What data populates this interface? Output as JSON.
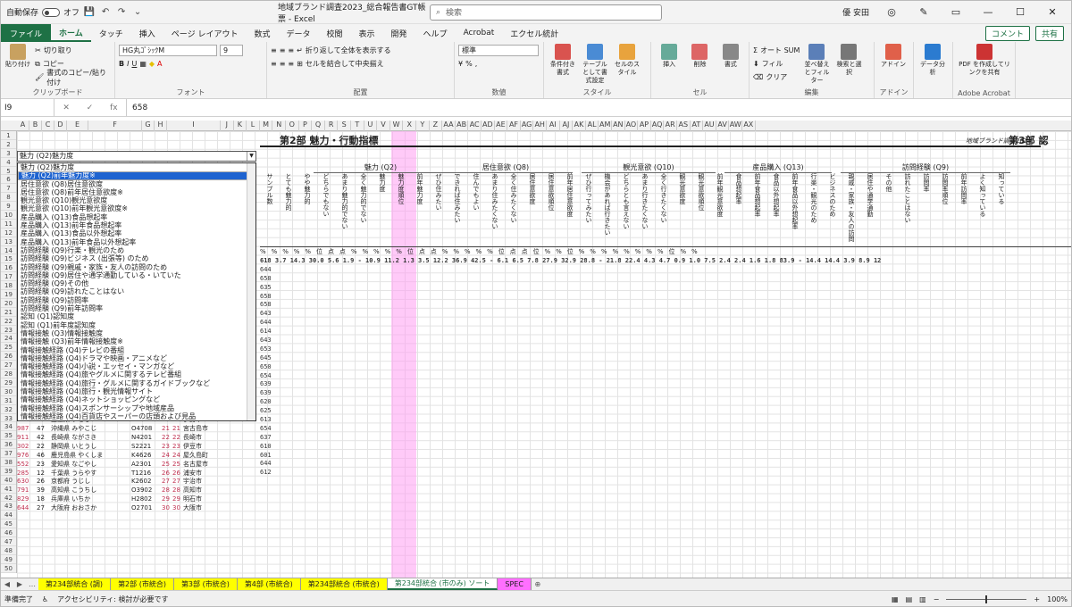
{
  "titlebar": {
    "autosave": "自動保存",
    "autosave_state": "オフ",
    "filename": "地域ブランド調査2023_総合報告書GT帳票 - Excel",
    "search_placeholder": "検索",
    "user": "優 安田"
  },
  "menu": {
    "file": "ファイル",
    "tabs": [
      "ホーム",
      "タッチ",
      "挿入",
      "ページ レイアウト",
      "数式",
      "データ",
      "校閲",
      "表示",
      "開発",
      "ヘルプ",
      "Acrobat",
      "エクセル統計"
    ],
    "comment": "コメント",
    "share": "共有"
  },
  "ribbon": {
    "clipboard": {
      "paste": "貼り付け",
      "cut": "切り取り",
      "copy": "コピー",
      "format_painter": "書式のコピー/貼り付け",
      "label": "クリップボード"
    },
    "font": {
      "name": "HG丸ｺﾞｼｯｸM",
      "size": "9",
      "label": "フォント"
    },
    "align": {
      "wrap": "折り返して全体を表示する",
      "merge": "セルを結合して中央揃え",
      "label": "配置"
    },
    "number": {
      "format": "標準",
      "label": "数値"
    },
    "style": {
      "cond": "条件付き書式",
      "table": "テーブルとして書式設定",
      "cell": "セルのスタイル",
      "label": "スタイル"
    },
    "cells": {
      "insert": "挿入",
      "delete": "削除",
      "format": "書式",
      "label": "セル"
    },
    "edit": {
      "autosum": "オート SUM",
      "fill": "フィル",
      "clear": "クリア",
      "sort": "並べ替えとフィルター",
      "find": "検索と選択",
      "label": "編集"
    },
    "addin": {
      "addin": "アドイン",
      "label": "アドイン"
    },
    "analysis": {
      "data": "データ分析"
    },
    "acrobat": {
      "pdf": "PDF を作成してリンクを共有",
      "label": "Adobe Acrobat"
    }
  },
  "formula": {
    "cell": "I9",
    "value": "658"
  },
  "colheaders": [
    "A",
    "B",
    "C",
    "D",
    "E",
    "F",
    "G",
    "H",
    "I",
    "J",
    "K",
    "L",
    "M",
    "N",
    "O",
    "P",
    "Q",
    "R",
    "S",
    "T",
    "U",
    "V",
    "W",
    "X",
    "Y",
    "Z",
    "AA",
    "AB",
    "AC",
    "AD",
    "AE",
    "AF",
    "AG",
    "AH",
    "AI",
    "AJ",
    "AK",
    "AL",
    "AM",
    "AN",
    "AO",
    "AP",
    "AQ",
    "AR",
    "AS",
    "AT",
    "AU",
    "AV",
    "AW",
    "AX"
  ],
  "sheet": {
    "section2": "第2部 魅力・行動指標",
    "section3": "第3部 認",
    "brand": "地域ブランド調査2023",
    "groups": [
      "魅力 (Q2)",
      "居住意欲 (Q8)",
      "観光意欲 (Q10)",
      "産品購入 (Q13)",
      "訪問経験 (Q9)"
    ],
    "dropdown_value": "魅力 (Q2)魅力度",
    "list": [
      "魅力 (Q2)魅力度",
      "魅力 (Q2)前年魅力度※",
      "居住意欲 (Q8)居住意欲度",
      "居住意欲 (Q8)前年居住意欲度※",
      "観光意欲 (Q10)観光意欲度",
      "観光意欲 (Q10)前年観光意欲度※",
      "産品購入 (Q13)食品想起率",
      "産品購入 (Q13)前年食品想起率",
      "産品購入 (Q13)食品以外想起率",
      "産品購入 (Q13)前年食品以外想起率",
      "訪問経験 (Q9)行楽・観光のため",
      "訪問経験 (Q9)ビジネス (出張等) のため",
      "訪問経験 (Q9)親戚・家族・友人の訪問のため",
      "訪問経験 (Q9)居住や通学通勤している・いていた",
      "訪問経験 (Q9)その他",
      "訪問経験 (Q9)訪れたことはない",
      "訪問経験 (Q9)訪問率",
      "訪問経験 (Q9)前年訪問率",
      "認知 (Q1)認知度",
      "認知 (Q1)前年度認知度",
      "情報接触 (Q3)情報接触度",
      "情報接触 (Q3)前年情報接触度※",
      "情報接触経路 (Q4)テレビの番組",
      "情報接触経路 (Q4)ドラマや映画・アニメなど",
      "情報接触経路 (Q4)小説・エッセイ・マンガなど",
      "情報接触経路 (Q4)旅やグルメに関するテレビ番組",
      "情報接触経路 (Q4)旅行・グルメに関するガイドブックなど",
      "情報接触経路 (Q4)旅行・観光情報サイト",
      "情報接触経路 (Q4)ネットショッピングなど",
      "情報接触経路 (Q4)スポンサーシップや地域産品",
      "情報接触経路 (Q4)百貨店やスーパーの店頭および見品"
    ],
    "vheaders": [
      "サンプル数",
      "とても魅力的",
      "やや魅力的",
      "どちらでもない",
      "あまり魅力的でない",
      "全く魅力的でない",
      "魅力度",
      "魅力度順位",
      "前年魅力度",
      "ぜひ住みたい",
      "できれば住みたい",
      "住んでもよい",
      "あまり住みたくない",
      "全く住みたくない",
      "居住意欲度",
      "居住意欲順位",
      "前年居住意欲度",
      "ぜひ行ってみたい",
      "機会があれば行きたい",
      "どちらとも言えない",
      "あまり行きたくない",
      "全く行きたくない",
      "観光意欲度",
      "観光意欲順位",
      "前年観光意欲度",
      "食品想起率",
      "前年食品想起率",
      "食品以外想起率",
      "前年食品以外想起率",
      "行楽・観光のため",
      "ビジネスのため",
      "親戚・家族・友人の訪問",
      "居住や通学通勤",
      "その他",
      "訪れたことはない",
      "訪問率",
      "訪問率順位",
      "前年訪問率",
      "よく知っている",
      "知っている"
    ],
    "totals": "618  3.7 14.3 30.0 5.6 1.9  -  10.9 11.2  1.3 3.5 12.2 36.9 42.5  -  6.1 6.5  7.8 27.9 32.9 28.8  - 21.8 22.4  4.3 4.7  0.9 1.0  7.5 2.4 2.4 1.6 1.8 83.9  - 14.4 14.4  3.9 8.9 12",
    "rows": [
      [
        "644",
        "36.6 45.4 13.9 2.3 0.6 1 59.4 63.9 10.0 10.9 25.7 26.5 25.5 2 21.9 23.7 40.6 41.2 11.3 6.2 1 61.2 65.9 2 43.8 47.2 39 3.6 4.3 28.9 5.8 5.1 6.2 2.0 59.2 15 40.1 40.2 17.9 29.7 25"
      ],
      [
        "658",
        "36.7 42.2 14.7 2.9 1.6 2 57.8 59.5 8.6 11.9 26.9 24.5 25.5 3 21.3 22.3 39.1 36.9 13.1 8.6 3 57.5 60.0 25 21.9 23.3 17 6.4 7.6 44.5 6.9 7.6 3.5 2.2 41.4 1 55.9 56.9 26.5 31.8 24"
      ],
      [
        "635",
        "32.9 47.3 15.0 1.6 1.7 3 56.6 58.7 4.2 8.6 25.2 30.0 31.5 20 12.8 15.9 38.2 43.4 9.8 7.5 2 59.9 62.3 5 33.8 35.5 49 3.0 3.1 27.2 4.3 3.9 1.6 0.7 69.8 34 33.8 33.9 11.7 26.0 25"
      ],
      [
        "658",
        "25.2 51.1 16.0 3.2 1.6 4 53.1 55.9 5.4 11.0 29.9 30.3 21.1 7 18.9 19.5 35.3 40.6 13.7 6.1 5 53.6 53.2 86 17.1 16.4 47 6.2 6.3 17.4 3.4 2.3 2.8 2.6 61.5 26 35.4 37.4 14.6 29.8 25"
      ],
      [
        "658",
        "29.6 44.7 18.0 2.5 1.0 5 52.0 52.1 3.7 15.2 30.5 26.2 20.9 6 18.9 20.4 30.7 42.8 14.2 10.1 7 52.1 51.9 113 8.9 10.4 60 2.8 5.2 34.0 2.9 2.6 2.1 2.0 53.5 2 41.2 38.8 18.3 27.0 28"
      ],
      [
        "643",
        "30.9 41.7 20.4 2.5 0.8 6 51.8 55.7 8.3 9.8 31.0 26.1 21.3 4 21.0 25.9 28.6 48.8 14.2 6.8 10 50.5 54.0 49 16.3 23.4 266 0.9 1.4 32.5 7.2 7.0 4.8 3.5 53.3 9 44.6 45.8 23.3 29.5 26"
      ],
      [
        "644",
        "30.8 39.7 22.6 3.5 1.7 7 50.7 56.1 11.3 13.1 31.8 25.9 15.3 1 26.9 21.6 38.4 31.5 18.2 9.0 11 51.5 51.0 59 12.4 14.1 24 8.7 9.1 37.1 10.7 11.0 5.7 4.0 44.6 2 55.6 56.7 26.0 31.6 22"
      ],
      [
        "614",
        "26.0 49.3 18.3 2.1 1.5 8 50.6 55.8 4.7 6.6 22.0 28.8 36.9 29 13.6 14.8 28.5 50.8 10.0 9.7 4 53.9 57.8 20 23.5 29.8 14 7.6 9.3 27.0 2.1 3.2 1.0 1.3 66.3 41 32.4 29.5 8.9 22.2 23"
      ],
      [
        "643",
        "29.0 34.8 25.0 5.7 1.3 9 48.8 49.0 6.1 6.1 19.4 27.8 34.6 17 15.0 17.9 31.3 39.1 14.0 13.5 8 50.9 54.8 23 19.6 27.1 31 4.3 6.5 27.7 2.6 1.8 2.4 1.8 63.1 31 34.9 32.7 17.2 34.0 24"
      ],
      [
        "653",
        "25.1 42.1 24.2 2.8 1.9 10 46.1 49.8 4.6 10.5 26.0 27.0 24.3 10 16.3 17.7 24.4 42.6 19.8 11.1 14 47.6 46.3 270 4.5 4.4 45 4.5 4.6 25.7 3.6 2.3 1.0 1.2 66.4 37 30.3 28.6 12.9 27.6 22"
      ],
      [
        "645",
        "23.9 43.3 19.5 3.5 1.1 11 45.5 49.0 3.1 7.1 21.1 29.0 36.8 48 12.0 16.9 26.0 47.7 13.0 12.1 12 49.9 54.5 43 17.1 22.4 13 8.4 11.0 17.8 1.6 1.8 0.9 1.6 75.5 146 22.5 21.5 8.8 25.3 21"
      ],
      [
        "650",
        "20.1 50.1 23.3 2.9 2.0 12 45.1 45.6 6.4 7.7 26.5 31.2 25.6 9 16.9 16.4 27.2 44.0 14.9 10.2 13 51.5 52.4 29 19.4 24.8 46 4.1 4.7 24.6 6.1 4.7 4.3 2.2 60.4 39 32.4 37.5 11.7 30.5 26"
      ],
      [
        "654",
        "16.5 53.1 23.9 2.2 1.4 13 43.0 45.8 2.8 9.1 23.7 31.8 29.9 31 13.3 15.4 22.7 46.9 17.9 10.6 18 46.1 51.2 158 7.0 10.5 144 1.4 2.0 31.7 3.3 2.7 1.5 1.8 58.3 18 38.9 40.1 9.6 26.6 25"
      ],
      [
        "639",
        "25.5 34.5 26.7 3.1 1.9 14 42.8 43.4 5.9 10.1 18.3 30.0 35.0 15 15.6 18.8 25.2 42.1 17.5 11.6 17 46.9 49.7 15 26.1 30.3 26 5.2 5.6 25.4 2.7 3.0 1.5 2.2 65.1 57 28.3 25.4 11.0 27.8 24"
      ],
      [
        "639",
        "22.3 40.9 26.0 3.2 2.6 15 42.8 43.0 5.2 6.9 20.4 32.4 34.6 55 11.7 13.4 24.1 40.5 15.9 14.2 16 47.7 48.3 243 4.8 6.8 66 2.5 3.7 24.3 2.8 2.6 1.7 1.2 66.9 51 30.3 30.4 13.3 22.9 25"
      ],
      [
        "620",
        "28.2 32.8 27.8 4.1 1.5 16 42.4 43.6 6.3 8.2 18.5 30.0 36.3 34 13.1 11.9 30.7 31.5 19.7 14.3 20 44.8 46.7 17 25.3 27.8 28 5.0 5.7 23.2 2.4 3.1 1.2 2.1 64.4 30 35.0 35.1 13.2 24.5 23"
      ],
      [
        "625",
        "18.9 45.1 24.8 4.3 1.1 17 40.7 42.3 2.2 9.5 24.9 32.1 30.5 26 13.7 15.5 21.1 45.2 17.3 13.6 21 43.2 46.3 194 6.1 6.9 40 4.7 6.0 24.8 3.0 2.4 1.3 1.1 66.7 53 28.6 29.4 10.4 27.7 26"
      ],
      [
        "613",
        "15.6 50.3 25.6 2.6 1.2 18 40.7 44.3 1.8 4.5 17.4 36.2 38.9 130 6.3 8.4 22.4 40.6 16.2 12.3 17 46.2 48.0 153 7.2 8.0 91 2.5 3.0 20.8 1.5 2.3 1.0 0.8 72.1 93 22.2 22.5 6.1 22.8 26"
      ],
      [
        "654",
        "17.3 46.6 24.7 3.6 1.0 19 40.5 38.4 3.0 7.5 21.8 31.8 33.0 43 12.2 13.8 23.9 43.2 17.5 13.0 20 45.4 45.5 254 4.7 6.5 37 3.9 5.3 30.6 2.7 2.7 1.6 1.9 59.9 21 37.6 34.2 16.2 27.2 25"
      ],
      [
        "637",
        "23.0 37.5 31.2 5.3 2.9 20 38.5 38.7 4.3 9.1 17.9 27.9 38.4 44 12.2 12.9 23.9 39.8 15.4 13.6 18 46.1 47.5 18 25.3 26.8 10 8.7 7.7 23.7 3.0 2.1 1.4 1.1 66.9 59 29.0 27.4 10.8 27.0 27"
      ],
      [
        "610",
        "16.8 43.2 27.1 6.2 2.2 21 38.4 39.0 1.6 5.8 27.5 30.9 31.4 63 11.3 12.9 27.8 41.6 17.3 9.6 15 48.6 49.8 19 23.6 28.8 52 2.9 3.6 28.1 2.6 2.7 2.0 0.9 60.3 23 37.9 37.4 13.9 27.7 22"
      ],
      [
        "601",
        "19.1 37.5 29.3 4.2 2.6 22 37.9 40.4 2.4 6.7 24.9 29.9 33.4 50 11.6 15.6 24.7 41.3 16.0 13.3 19 48.1 50.2 20 22.7 21.3 22 6.9 7.6 24.2 5.0 6.1 3.2 1.6 59.8 25 36.3 41.8 12.0 28.1 25"
      ],
      [
        "644",
        "17.5 39.4 28.0 5.5 2.2 23 37.4 38.8 2.2 6.7 22.0 32.1 33.8 60 11.0 10.7 23.2 42.7 18.5 11.9 24 45.1 46.4 186 6.3 9.0 36 4.5 6.8 25.6 3.5 2.4 1.4 1.4 63.2 36 31.6 31.1 12.1 25.7 23"
      ],
      [
        "612",
        "16.2 41.0 30.3 4.9 1.3 24 37.0 38.3 2.7 6.9 23.7 33.5 30.7 60 11.2 13.4 21.4 41.5 21.7 11.4 22 42.9 44.1 66 11.8 13.3 33 5.6 6.4 26.3 3.2 2.8 2.0 0.6 63.4 49 31.1 30.9 12.2 28.2 24"
      ]
    ],
    "left_rows": [
      [
        "22",
        "225",
        "5",
        "4 仙台市 せんだいし",
        "04100",
        "18",
        "18",
        "仙台市"
      ],
      [
        "23",
        "209",
        "8",
        "栃木県 にっこう",
        "T0914",
        "16",
        "16",
        "日光市"
      ],
      [
        "24",
        "184",
        "34",
        "神奈川県 はこね",
        "K1424",
        "18",
        "18",
        "箱根町"
      ],
      [
        "25",
        "852",
        "40",
        "福岡県 ふくおか",
        "H4002",
        "19",
        "19",
        "福岡市"
      ],
      [
        "26",
        "785",
        "24",
        "三重県 いせし",
        "M2407",
        "20",
        "20",
        "伊勢市"
      ],
      [
        "27",
        "987",
        "47",
        "沖縄県 みやこじ",
        "O4708",
        "21",
        "21",
        "宮古島市"
      ],
      [
        "28",
        "911",
        "42",
        "長崎県 ながさき",
        "N4201",
        "22",
        "22",
        "長崎市"
      ],
      [
        "29",
        "302",
        "22",
        "静岡県 いとうし",
        "S2221",
        "23",
        "23",
        "伊豆市"
      ],
      [
        "30",
        "976",
        "46",
        "鹿児島県 やくしま",
        "K4626",
        "24",
        "24",
        "屋久島町"
      ],
      [
        "31",
        "552",
        "23",
        "愛知県 なごやし",
        "A2301",
        "25",
        "25",
        "名古屋市"
      ],
      [
        "32",
        "285",
        "12",
        "千葉県 うらやす",
        "T1216",
        "26",
        "26",
        "浦安市"
      ],
      [
        "33",
        "630",
        "26",
        "京都府 うじし",
        "K2602",
        "27",
        "27",
        "宇治市"
      ],
      [
        "34",
        "791",
        "39",
        "高知県 こうちし",
        "O3902",
        "28",
        "28",
        "高知市"
      ],
      [
        "35",
        "829",
        "18",
        "兵庫県 いちか",
        "H2802",
        "29",
        "29",
        "明石市"
      ],
      [
        "36",
        "644",
        "27",
        "大阪府 おおさか",
        "O2701",
        "30",
        "30",
        "大阪市"
      ]
    ],
    "units": "%  %  %  %  %  位  点  点  %  %  %  %  %  位  点  点  %  %  %  %  %  位  点  点  位  %  %  位  %  %  %  %  %  %  %  %  位  %  %"
  },
  "tabs": [
    "第234部統合 (調)",
    "第2部 (市統合)",
    "第3部 (市統合)",
    "第4部 (市統合)",
    "第234部統合 (市統合)",
    "第234部統合 (市のみ) ソート",
    "SPEC"
  ],
  "status": {
    "ready": "準備完了",
    "accessibility": "アクセシビリティ: 検討が必要です",
    "zoom": "100%"
  }
}
